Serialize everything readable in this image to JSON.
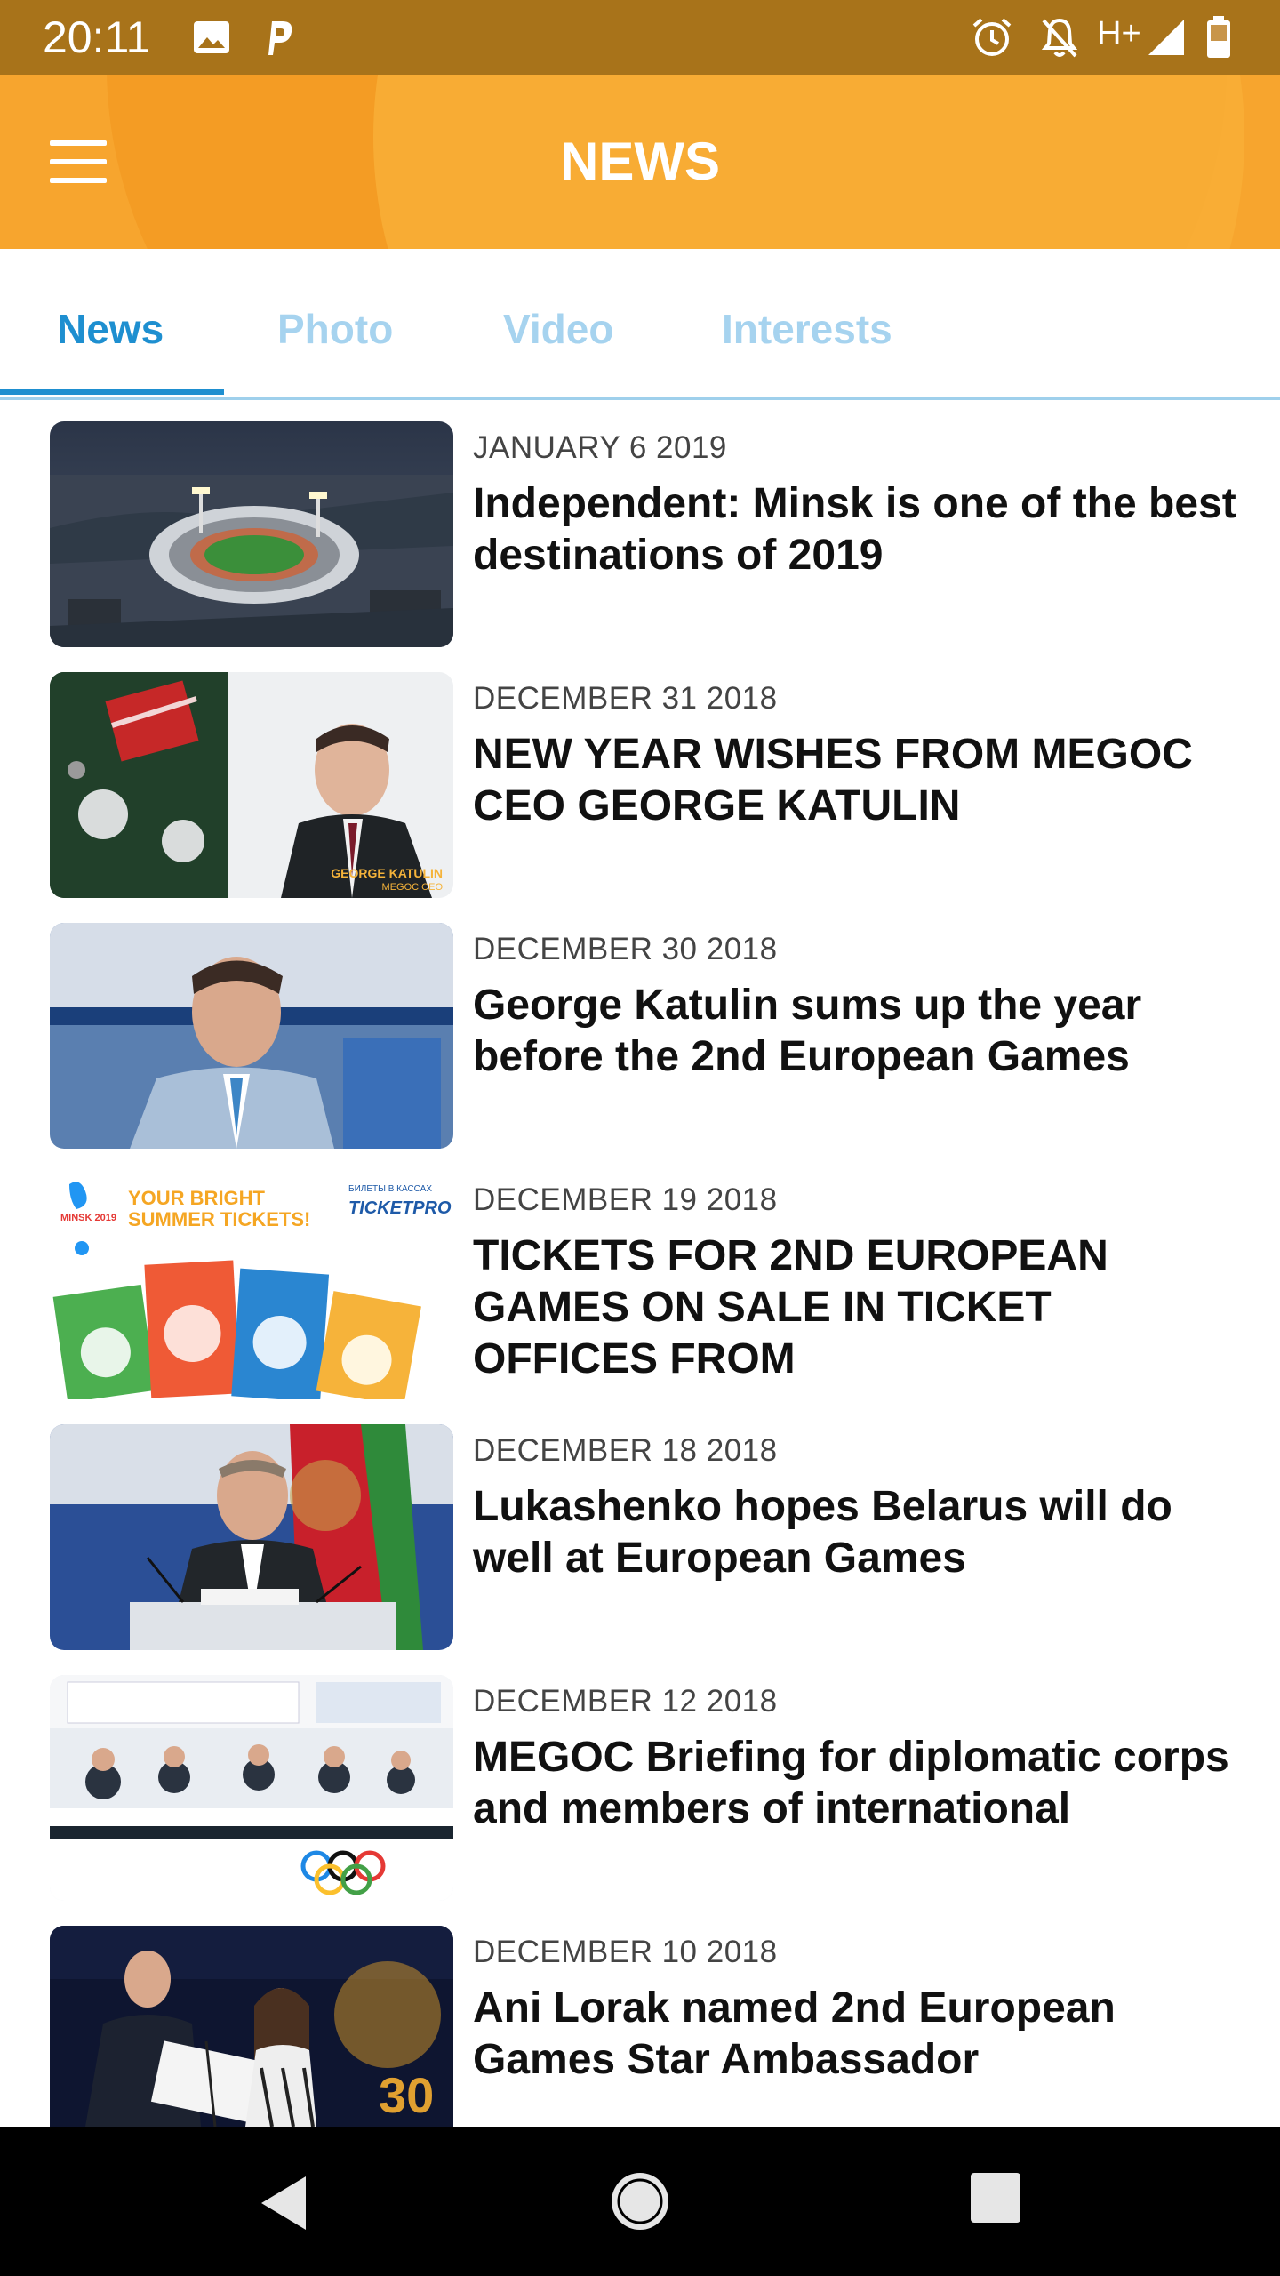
{
  "status_bar": {
    "time": "20:11",
    "network": "H+",
    "icons": [
      "image-icon",
      "parking-p-icon",
      "alarm-icon",
      "notifications-off-icon",
      "signal-icon",
      "battery-icon"
    ]
  },
  "app_bar": {
    "title": "NEWS",
    "menu_icon": "hamburger-menu-icon",
    "brand_color": "#f7a52e"
  },
  "tabs": {
    "active_color": "#1e8fd0",
    "inactive_color": "#a6d3ef",
    "items": [
      {
        "label": "News",
        "active": true
      },
      {
        "label": "Photo",
        "active": false
      },
      {
        "label": "Video",
        "active": false
      },
      {
        "label": "Interests",
        "active": false
      }
    ]
  },
  "news": [
    {
      "date": "JANUARY 6 2019",
      "title": "Independent: Minsk is one of the best destinations of 2019",
      "image": "stadium-aerial-photo"
    },
    {
      "date": "DECEMBER 31 2018",
      "title": "NEW YEAR WISHES FROM MEGOC CEO GEORGE KATULIN",
      "image": "christmas-portrait-photo",
      "image_caption_name": "GEORGE KATULIN",
      "image_caption_role": "MEGOC CEO"
    },
    {
      "date": "DECEMBER 30 2018",
      "title": "George Katulin sums up the year before the 2nd European Games",
      "image": "portrait-photo"
    },
    {
      "date": "DECEMBER 19 2018",
      "title": "TICKETS FOR 2ND EUROPEAN GAMES ON SALE IN TICKET OFFICES FROM",
      "image": "tickets-banner",
      "banner_text": "YOUR BRIGHT SUMMER TICKETS!",
      "banner_brand": "TICKETPRO",
      "banner_brand_sub": "БИЛЕТЫ В КАССАХ",
      "banner_logo": "MINSK 2019"
    },
    {
      "date": "DECEMBER 18 2018",
      "title": "Lukashenko hopes Belarus will do well at European Games",
      "image": "press-conference-photo"
    },
    {
      "date": "DECEMBER 12 2018",
      "title": "MEGOC Briefing for diplomatic corps and members of international",
      "image": "briefing-photo"
    },
    {
      "date": "DECEMBER 10 2018",
      "title": "Ani Lorak named 2nd European Games Star Ambassador",
      "image": "ceremony-photo"
    }
  ],
  "nav_bar": {
    "back": "back-triangle-icon",
    "home": "home-circle-icon",
    "recents": "recents-square-icon"
  }
}
